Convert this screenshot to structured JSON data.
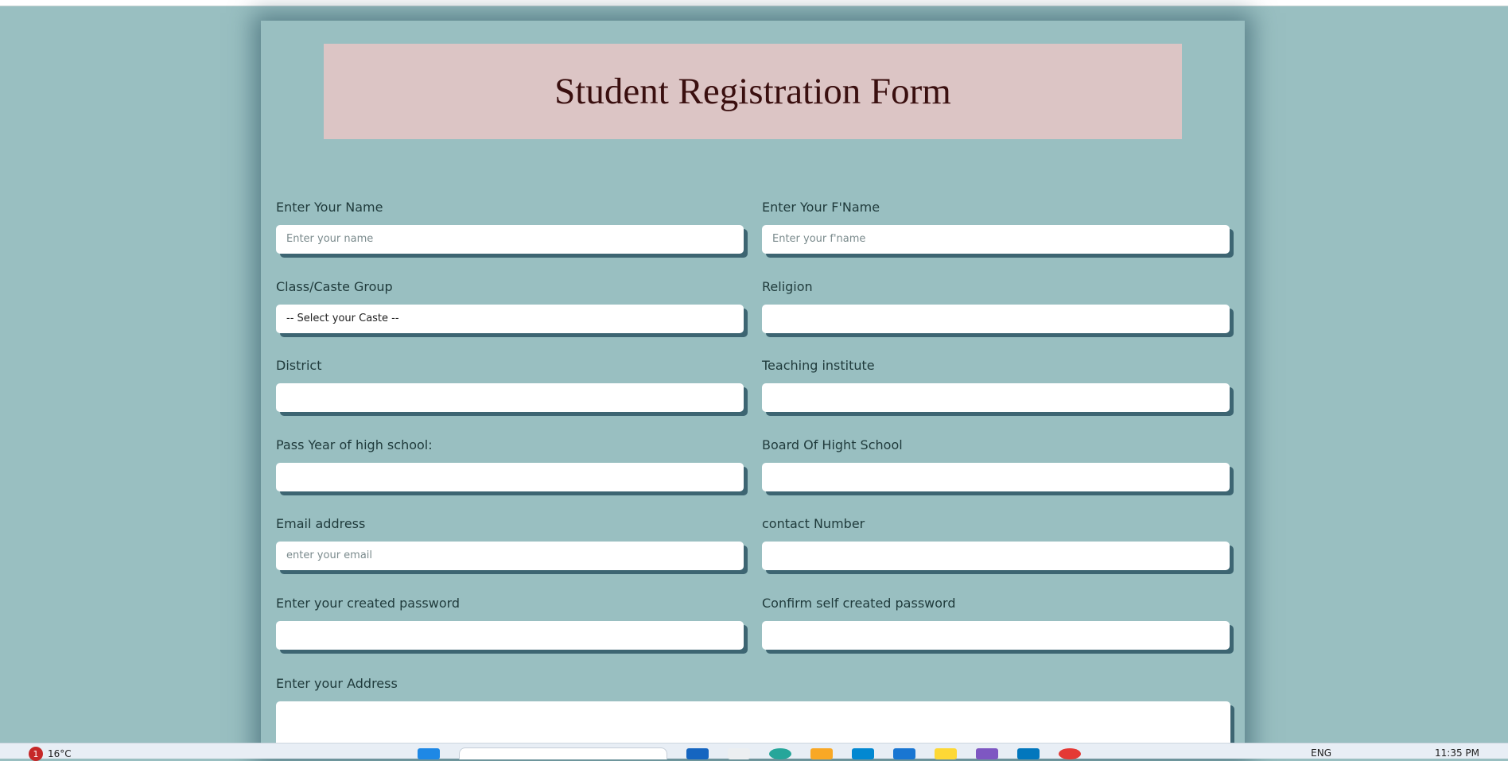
{
  "form": {
    "title": "Student Registration Form",
    "fields": {
      "name": {
        "label": "Enter Your Name",
        "placeholder": "Enter your name"
      },
      "fname": {
        "label": "Enter Your F'Name",
        "placeholder": "Enter your f'name"
      },
      "caste": {
        "label": "Class/Caste Group",
        "selected": "-- Select your Caste --"
      },
      "religion": {
        "label": "Religion",
        "value": ""
      },
      "district": {
        "label": "District",
        "value": ""
      },
      "institute": {
        "label": "Teaching institute",
        "value": ""
      },
      "pass_year": {
        "label": "Pass Year of high school:",
        "value": ""
      },
      "board": {
        "label": "Board Of Hight School",
        "value": ""
      },
      "email": {
        "label": "Email address",
        "placeholder": "enter your email"
      },
      "contact": {
        "label": "contact Number",
        "value": ""
      },
      "password": {
        "label": "Enter your created password",
        "value": ""
      },
      "confirm_password": {
        "label": "Confirm self created password",
        "value": ""
      },
      "address": {
        "label": "Enter your Address",
        "value": ""
      }
    }
  },
  "taskbar": {
    "weather_badge": "1",
    "temperature": "16°C",
    "language": "ENG",
    "time": "11:35 PM",
    "icons": [
      "windows-start-icon",
      "search-box",
      "copilot-icon",
      "file-icon",
      "edge-icon",
      "folder-icon",
      "store-icon",
      "mail-icon",
      "sticky-notes-icon",
      "vs-icon",
      "app-icon",
      "chrome-icon"
    ]
  }
}
